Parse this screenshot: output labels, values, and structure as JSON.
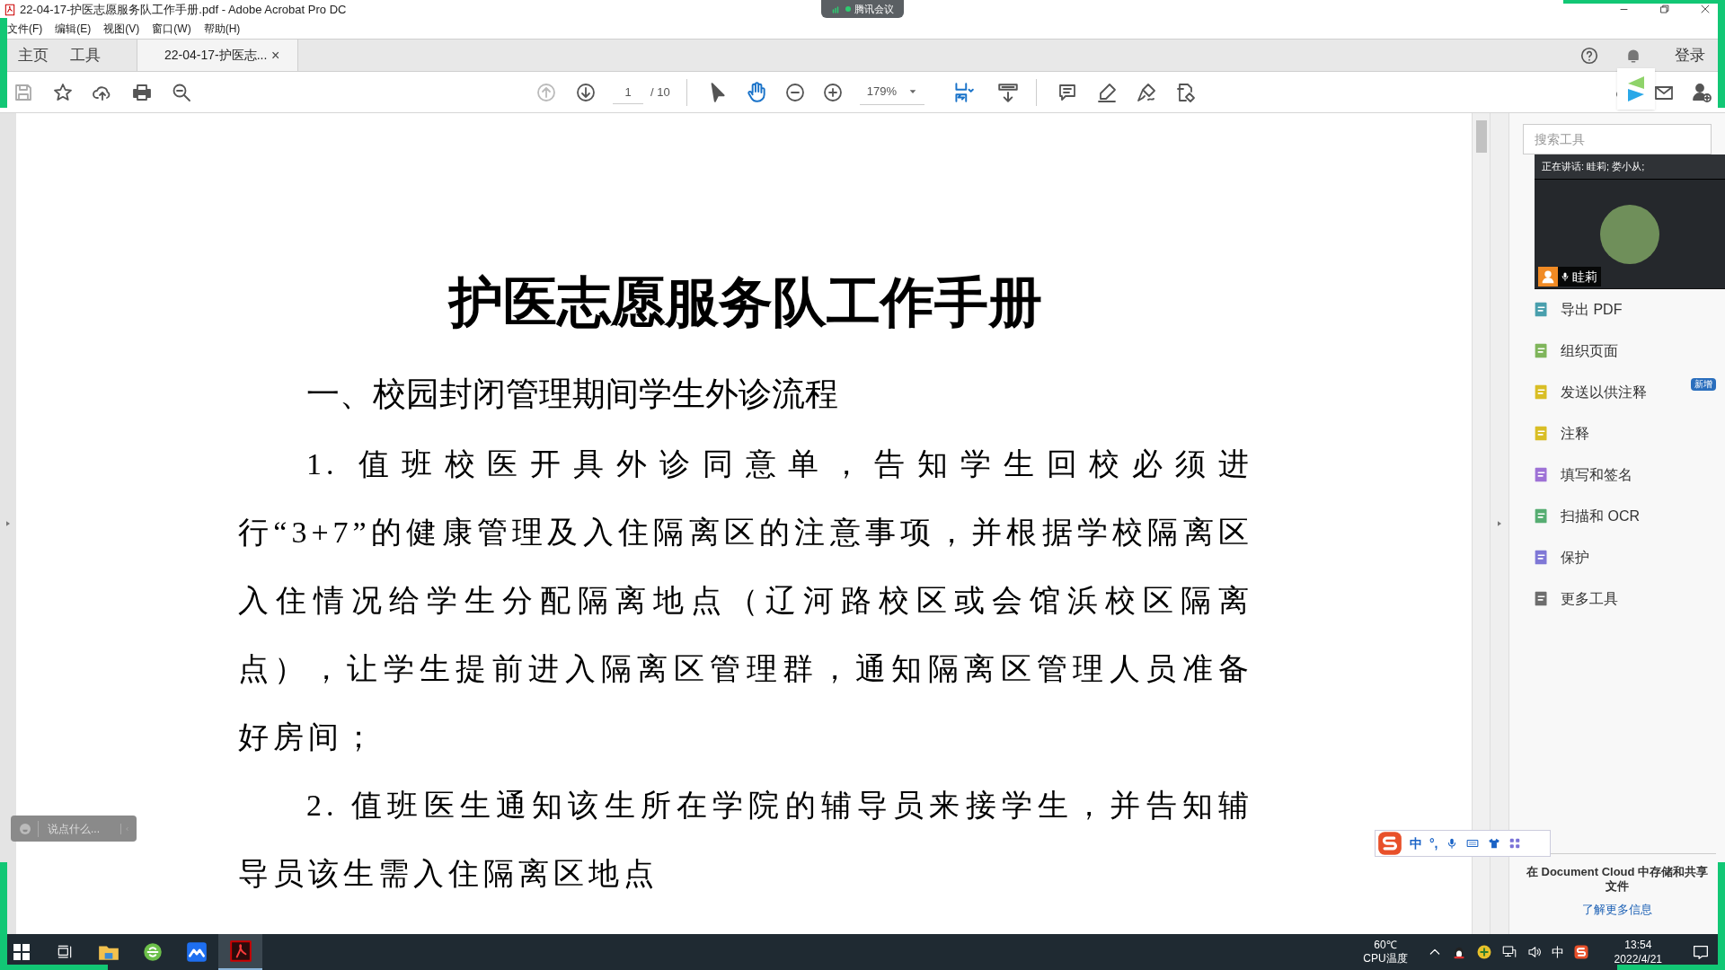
{
  "window": {
    "title": "22-04-17-护医志愿服务队工作手册.pdf - Adobe Acrobat Pro DC"
  },
  "menu": [
    "文件(F)",
    "编辑(E)",
    "视图(V)",
    "窗口(W)",
    "帮助(H)"
  ],
  "nav_tabs": [
    {
      "label": "主页",
      "selected": false
    },
    {
      "label": "工具",
      "selected": false
    }
  ],
  "doc_tab": {
    "label": "22-04-17-护医志...",
    "close": "×",
    "selected": true
  },
  "account": {
    "login": "登录"
  },
  "toolbar": {
    "page": "1",
    "page_total": "/ 10",
    "zoom": "179%",
    "tools": [
      {
        "selected": false
      },
      {
        "selected": true
      }
    ]
  },
  "document": {
    "title": "护医志愿服务队工作手册",
    "heading": "一、校园封闭管理期间学生外诊流程",
    "paragraphs": [
      "1. 值班校医开具外诊同意单，告知学生回校必须进行“3+7”的健康管理及入住隔离区的注意事项，并根据学校隔离区入住情况给学生分配隔离地点（辽河路校区或会馆浜校区隔离点），让学生提前进入隔离区管理群，通知隔离区管理人员准备好房间；",
      "2. 值班医生通知该生所在学院的辅导员来接学生，并告知辅导员该生需入住隔离区地点"
    ]
  },
  "tools_panel": {
    "search_placeholder": "搜索工具",
    "items": [
      {
        "label": "导出 PDF"
      },
      {
        "label": "组织页面"
      },
      {
        "label": "发送以供注释",
        "badge": "新增"
      },
      {
        "label": "注释"
      },
      {
        "label": "填写和签名"
      },
      {
        "label": "扫描和 OCR"
      },
      {
        "label": "保护"
      },
      {
        "label": "更多工具"
      }
    ],
    "cloud_text": "在 Document Cloud 中存储和共享文件",
    "cloud_link": "了解更多信息"
  },
  "meeting": {
    "badge": "腾讯会议",
    "speaking": "正在讲话: 眭莉; 娄小从;",
    "participant": "眭莉",
    "chat_placeholder": "说点什么..."
  },
  "ime": {
    "mode": "中",
    "punct": "°,"
  },
  "taskbar": {
    "apps": [
      {
        "active": false
      },
      {
        "active": false
      },
      {
        "active": false
      },
      {
        "active": true
      }
    ],
    "temp": "60℃",
    "temp_label": "CPU温度",
    "ime": "中",
    "time": "13:54",
    "date": "2022/4/21"
  }
}
